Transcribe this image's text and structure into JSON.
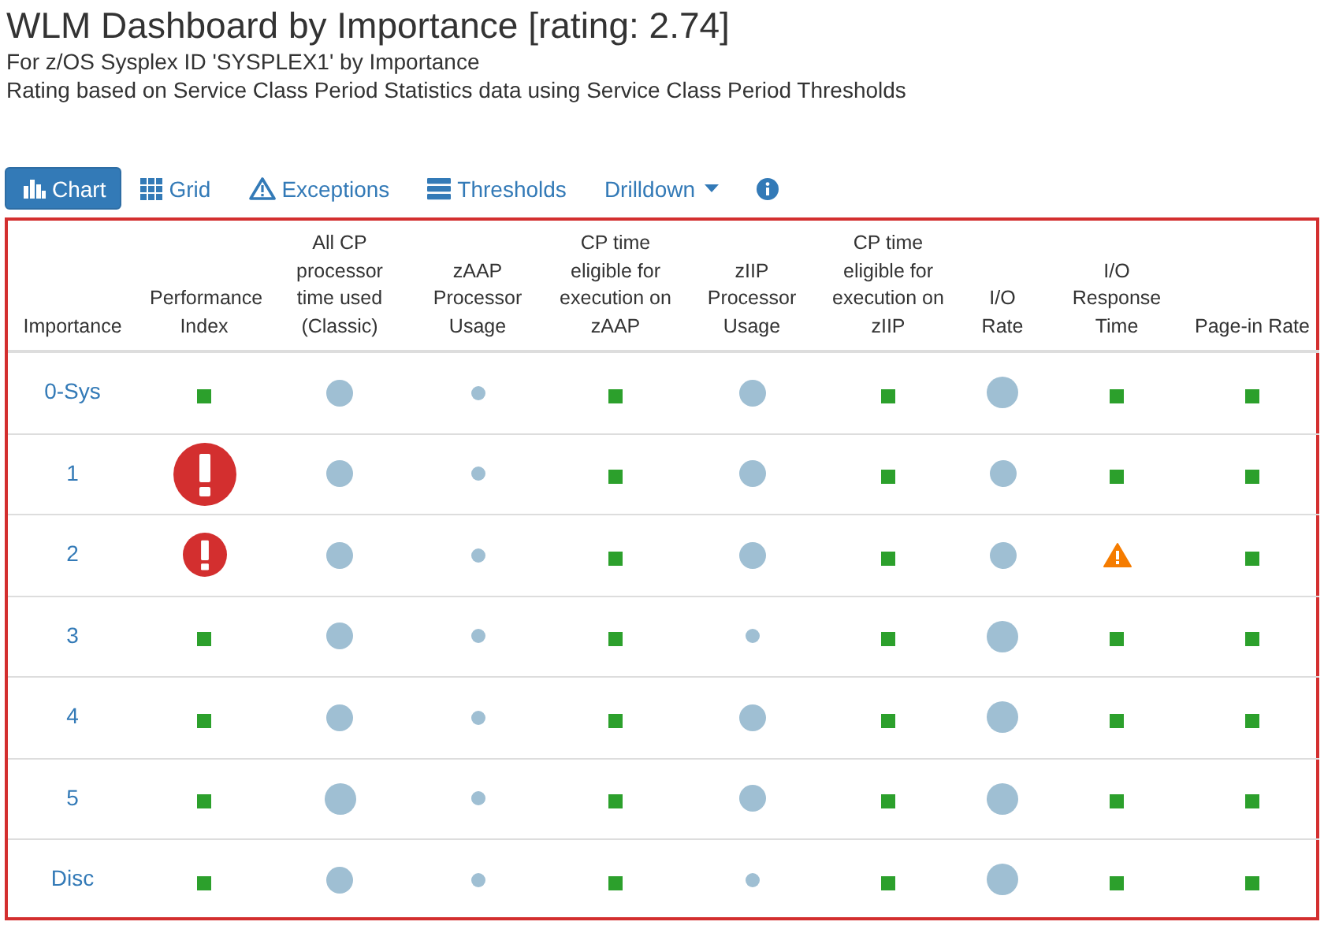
{
  "header": {
    "title": "WLM Dashboard by Importance [rating: 2.74]",
    "subtitle": "For z/OS Sysplex ID 'SYSPLEX1' by Importance",
    "description": "Rating based on Service Class Period Statistics data using Service Class Period Thresholds"
  },
  "tabs": [
    {
      "label": "Chart",
      "selected": true
    },
    {
      "label": "Grid",
      "selected": false
    },
    {
      "label": "Exceptions",
      "selected": false
    },
    {
      "label": "Thresholds",
      "selected": false
    },
    {
      "label": "Drilldown",
      "selected": false
    },
    {
      "selected": false
    }
  ],
  "table": {
    "columns": [
      "Importance",
      "Performance Index",
      "All CP processor time used (Classic)",
      "zAAP Processor Usage",
      "CP time eligible for execution on zAAP",
      "zIIP Processor Usage",
      "CP time eligible for execution on zIIP",
      "I/O Rate",
      "I/O Response Time",
      "Page-in Rate"
    ],
    "rows": [
      {
        "importance": "0-Sys",
        "cells": [
          {
            "kind": "ok"
          },
          {
            "kind": "bubble"
          },
          {
            "kind": "dot"
          },
          {
            "kind": "ok"
          },
          {
            "kind": "bubble"
          },
          {
            "kind": "ok"
          },
          {
            "kind": "bigbubble"
          },
          {
            "kind": "ok"
          },
          {
            "kind": "ok"
          }
        ]
      },
      {
        "importance": "1",
        "cells": [
          {
            "kind": "critical"
          },
          {
            "kind": "bubble"
          },
          {
            "kind": "dot"
          },
          {
            "kind": "ok"
          },
          {
            "kind": "bubble"
          },
          {
            "kind": "ok"
          },
          {
            "kind": "bubble"
          },
          {
            "kind": "ok"
          },
          {
            "kind": "ok"
          }
        ]
      },
      {
        "importance": "2",
        "cells": [
          {
            "kind": "alert"
          },
          {
            "kind": "bubble"
          },
          {
            "kind": "dot"
          },
          {
            "kind": "ok"
          },
          {
            "kind": "bubble"
          },
          {
            "kind": "ok"
          },
          {
            "kind": "bubble"
          },
          {
            "kind": "warning"
          },
          {
            "kind": "ok"
          }
        ]
      },
      {
        "importance": "3",
        "cells": [
          {
            "kind": "ok"
          },
          {
            "kind": "bubble"
          },
          {
            "kind": "dot"
          },
          {
            "kind": "ok"
          },
          {
            "kind": "dot"
          },
          {
            "kind": "ok"
          },
          {
            "kind": "bigbubble"
          },
          {
            "kind": "ok"
          },
          {
            "kind": "ok"
          }
        ]
      },
      {
        "importance": "4",
        "cells": [
          {
            "kind": "ok"
          },
          {
            "kind": "bubble"
          },
          {
            "kind": "dot"
          },
          {
            "kind": "ok"
          },
          {
            "kind": "bubble"
          },
          {
            "kind": "ok"
          },
          {
            "kind": "bigbubble"
          },
          {
            "kind": "ok"
          },
          {
            "kind": "ok"
          }
        ]
      },
      {
        "importance": "5",
        "cells": [
          {
            "kind": "ok"
          },
          {
            "kind": "bigbubble"
          },
          {
            "kind": "dot"
          },
          {
            "kind": "ok"
          },
          {
            "kind": "bubble"
          },
          {
            "kind": "ok"
          },
          {
            "kind": "bigbubble"
          },
          {
            "kind": "ok"
          },
          {
            "kind": "ok"
          }
        ]
      },
      {
        "importance": "Disc",
        "cells": [
          {
            "kind": "ok"
          },
          {
            "kind": "bubble"
          },
          {
            "kind": "dot"
          },
          {
            "kind": "ok"
          },
          {
            "kind": "dot"
          },
          {
            "kind": "ok"
          },
          {
            "kind": "bigbubble"
          },
          {
            "kind": "ok"
          },
          {
            "kind": "ok"
          }
        ]
      }
    ]
  }
}
